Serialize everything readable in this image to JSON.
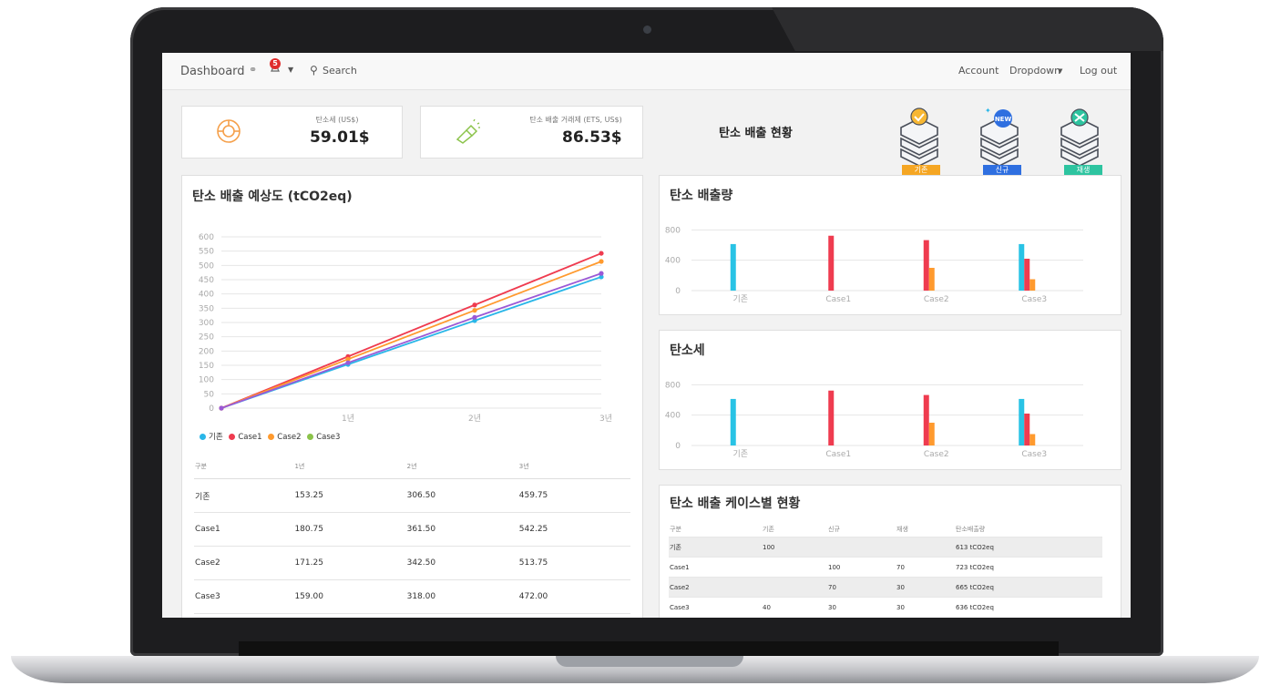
{
  "nav": {
    "brand": "Dashboard",
    "badge_count": "5",
    "search_label": "Search",
    "account": "Account",
    "dropdown": "Dropdown",
    "logout": "Log out"
  },
  "kpis": [
    {
      "label": "탄소세 (US$)",
      "value": "59.01$",
      "icon": "pie-chart-icon",
      "color": "#f5a04b"
    },
    {
      "label": "탄소 배출 거래제 (ETS, US$)",
      "value": "86.53$",
      "icon": "flashlight-icon",
      "color": "#8bc34a"
    }
  ],
  "status": {
    "title": "탄소 배출 현황",
    "servers": [
      {
        "tag": "기존",
        "icon": "server-check-icon",
        "tag_color": "#f5a623"
      },
      {
        "tag": "신규",
        "icon": "server-new-icon",
        "tag_color": "#2f6fe0"
      },
      {
        "tag": "재생",
        "icon": "server-recycle-icon",
        "tag_color": "#2ec4a0"
      }
    ]
  },
  "forecast": {
    "title": "탄소 배출 예상도 (tCO2eq)",
    "legend": [
      {
        "name": "기존",
        "color": "#29b6e8"
      },
      {
        "name": "Case1",
        "color": "#ef3b4f"
      },
      {
        "name": "Case2",
        "color": "#ff9a2e"
      },
      {
        "name": "Case3",
        "color": "#8bc34a"
      }
    ],
    "table": {
      "headers": [
        "구분",
        "1년",
        "2년",
        "3년"
      ],
      "rows": [
        [
          "기존",
          "153.25",
          "306.50",
          "459.75"
        ],
        [
          "Case1",
          "180.75",
          "361.50",
          "542.25"
        ],
        [
          "Case2",
          "171.25",
          "342.50",
          "513.75"
        ],
        [
          "Case3",
          "159.00",
          "318.00",
          "472.00"
        ]
      ]
    }
  },
  "emission_card": {
    "title": "탄소 배출량"
  },
  "tax_card": {
    "title": "탄소세"
  },
  "case_status": {
    "title": "탄소 배출 케이스별 현황",
    "headers": [
      "구분",
      "기존",
      "신규",
      "재생",
      "탄소배출량"
    ],
    "rows": [
      [
        "기존",
        "100",
        "",
        "",
        "613 tCO2eq"
      ],
      [
        "Case1",
        "",
        "100",
        "70",
        "723 tCO2eq"
      ],
      [
        "Case2",
        "",
        "70",
        "30",
        "665 tCO2eq"
      ],
      [
        "Case3",
        "40",
        "30",
        "30",
        "636 tCO2eq"
      ]
    ]
  },
  "chart_data": [
    {
      "type": "line",
      "x": [
        "0",
        "1년",
        "2년",
        "3년"
      ],
      "xlabels": [
        "",
        "1년",
        "2년",
        "3년"
      ],
      "ylim": [
        0,
        600
      ],
      "yticks": [
        0,
        50,
        100,
        150,
        200,
        250,
        300,
        350,
        400,
        450,
        500,
        550,
        600
      ],
      "series": [
        {
          "name": "기존",
          "color": "#29b6e8",
          "values": [
            0,
            153.25,
            306.5,
            459.75
          ]
        },
        {
          "name": "Case1",
          "color": "#ef3b4f",
          "values": [
            0,
            180.75,
            361.5,
            542.25
          ]
        },
        {
          "name": "Case2",
          "color": "#ff9a2e",
          "values": [
            0,
            171.25,
            342.5,
            513.75
          ]
        },
        {
          "name": "Case3",
          "color": "#9b59d6",
          "values": [
            0,
            159.0,
            318.0,
            472.0
          ]
        }
      ],
      "grid": true
    },
    {
      "type": "bar",
      "categories": [
        "기존",
        "Case1",
        "Case2",
        "Case3"
      ],
      "yticks": [
        0,
        400,
        800
      ],
      "ylim": [
        0,
        900
      ],
      "series": [
        {
          "name": "기존",
          "color": "#29c3e5",
          "values": [
            613,
            0,
            0,
            613
          ]
        },
        {
          "name": "Case1",
          "color": "#ef3b4f",
          "values": [
            0,
            723,
            665,
            420
          ]
        },
        {
          "name": "Case2",
          "color": "#ff9a2e",
          "values": [
            0,
            0,
            300,
            150
          ]
        }
      ]
    },
    {
      "type": "bar",
      "categories": [
        "기존",
        "Case1",
        "Case2",
        "Case3"
      ],
      "yticks": [
        0,
        400,
        800
      ],
      "ylim": [
        0,
        900
      ],
      "series": [
        {
          "name": "기존",
          "color": "#29c3e5",
          "values": [
            613,
            0,
            0,
            613
          ]
        },
        {
          "name": "Case1",
          "color": "#ef3b4f",
          "values": [
            0,
            723,
            665,
            420
          ]
        },
        {
          "name": "Case2",
          "color": "#ff9a2e",
          "values": [
            0,
            0,
            300,
            150
          ]
        }
      ]
    }
  ]
}
